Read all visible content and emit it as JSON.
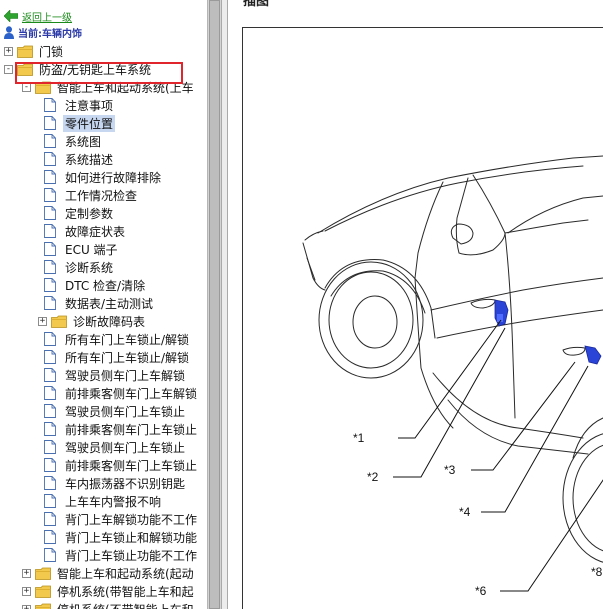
{
  "nav": {
    "back_label": "返回上一级",
    "current_label": "当前:车辆内饰"
  },
  "tree": [
    {
      "label": "门锁",
      "expander": "+"
    },
    {
      "label": "防盗/无钥匙上车系统",
      "expander": "-"
    },
    {
      "label": "智能上车和起动系统(上车",
      "expander": "-"
    },
    {
      "label": "注意事项"
    },
    {
      "label": "零件位置",
      "selected": true
    },
    {
      "label": "系统图"
    },
    {
      "label": "系统描述"
    },
    {
      "label": "如何进行故障排除"
    },
    {
      "label": "工作情况检查"
    },
    {
      "label": "定制参数"
    },
    {
      "label": "故障症状表"
    },
    {
      "label": "ECU 端子"
    },
    {
      "label": "诊断系统"
    },
    {
      "label": "DTC 检查/清除"
    },
    {
      "label": "数据表/主动测试"
    },
    {
      "label": "诊断故障码表",
      "expander": "+"
    },
    {
      "label": "所有车门上车锁止/解锁"
    },
    {
      "label": "所有车门上车锁止/解锁"
    },
    {
      "label": "驾驶员侧车门上车解锁"
    },
    {
      "label": "前排乘客侧车门上车解锁"
    },
    {
      "label": "驾驶员侧车门上车锁止"
    },
    {
      "label": "前排乘客侧车门上车锁止"
    },
    {
      "label": "驾驶员侧车门上车锁止"
    },
    {
      "label": "前排乘客侧车门上车锁止"
    },
    {
      "label": "车内振荡器不识别钥匙"
    },
    {
      "label": "上车车内警报不响"
    },
    {
      "label": "背门上车解锁功能不工作"
    },
    {
      "label": "背门上车锁止和解锁功能"
    },
    {
      "label": "背门上车锁止功能不工作"
    },
    {
      "label": "智能上车和起动系统(起动",
      "expander": "+"
    },
    {
      "label": "停机系统(带智能上车和起",
      "expander": "+"
    },
    {
      "label": "停机系统(不带智能上车和",
      "expander": "+"
    }
  ],
  "content": {
    "heading_fragment": "插图",
    "callouts": [
      "*1",
      "*2",
      "*3",
      "*4",
      "*6",
      "*8"
    ]
  }
}
